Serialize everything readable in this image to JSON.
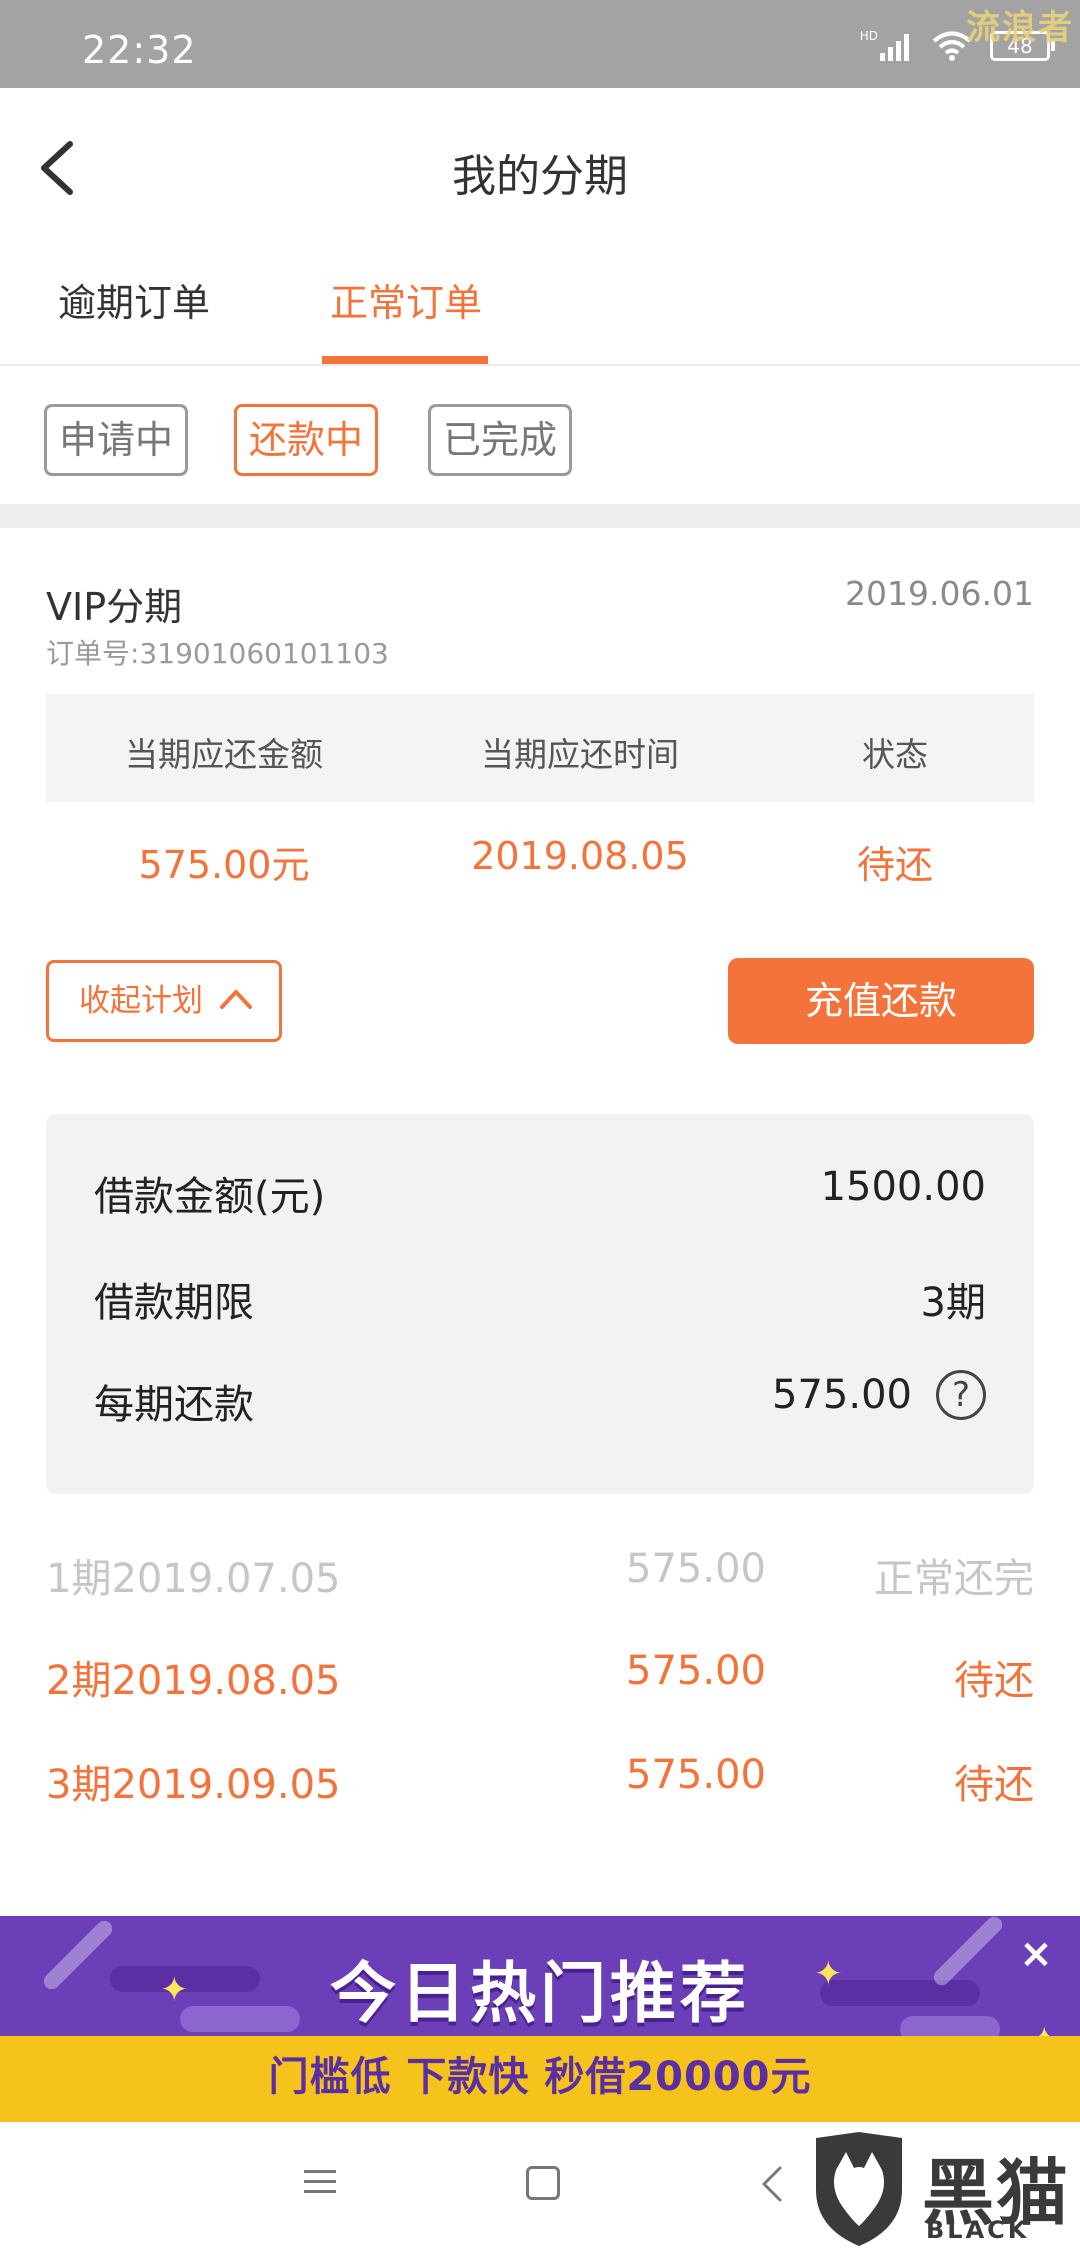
{
  "status_bar": {
    "time": "22:32",
    "network": "HD",
    "battery": "48",
    "watermark": "流浪者"
  },
  "header": {
    "title": "我的分期"
  },
  "tabs": [
    {
      "label": "逾期订单",
      "active": false
    },
    {
      "label": "正常订单",
      "active": true
    }
  ],
  "filters": [
    {
      "label": "申请中",
      "active": false
    },
    {
      "label": "还款中",
      "active": true
    },
    {
      "label": "已完成",
      "active": false
    }
  ],
  "order": {
    "name": "VIP分期",
    "date": "2019.06.01",
    "order_no": "订单号:31901060101103",
    "summary_headers": [
      "当期应还金额",
      "当期应还时间",
      "状态"
    ],
    "summary_values": [
      "575.00元",
      "2019.08.05",
      "待还"
    ],
    "collapse_label": "收起计划",
    "pay_label": "充值还款"
  },
  "details": [
    {
      "label": "借款金额(元)",
      "value": "1500.00"
    },
    {
      "label": "借款期限",
      "value": "3期"
    },
    {
      "label": "每期还款",
      "value": "575.00",
      "help": "?"
    }
  ],
  "schedule": [
    {
      "period": "1期2019.07.05",
      "amount": "575.00",
      "status": "正常还完",
      "state": "done"
    },
    {
      "period": "2期2019.08.05",
      "amount": "575.00",
      "status": "待还",
      "state": "pending"
    },
    {
      "period": "3期2019.09.05",
      "amount": "575.00",
      "status": "待还",
      "state": "pending"
    }
  ],
  "ad": {
    "title": "今日热门推荐",
    "subtitle": "门槛低 下款快 秒借20000元",
    "close": "×"
  },
  "logo": {
    "cn": "黑猫",
    "en": "BLACK CAT"
  },
  "colors": {
    "accent": "#f4733a",
    "ad_purple": "#6a3fb8",
    "ad_yellow": "#f6c21c",
    "status_bar": "#a3a3a3"
  }
}
